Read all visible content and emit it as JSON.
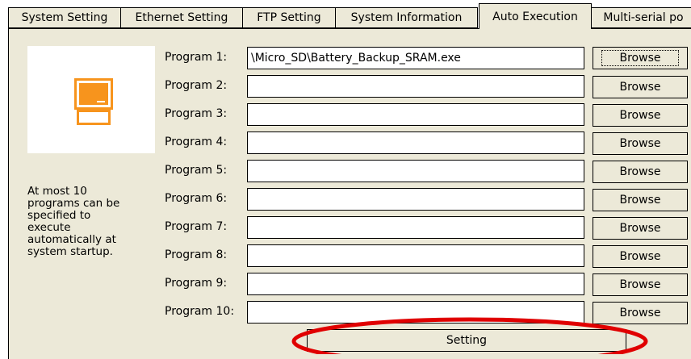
{
  "tabs": [
    {
      "label": "System Setting",
      "active": false
    },
    {
      "label": "Ethernet Setting",
      "active": false
    },
    {
      "label": "FTP Setting",
      "active": false
    },
    {
      "label": "System Information",
      "active": false
    },
    {
      "label": "Auto Execution",
      "active": true
    },
    {
      "label": "Multi-serial po",
      "active": false
    }
  ],
  "icon": {
    "name": "computer-icon",
    "color": "#f7941d"
  },
  "note": "At most 10\nprograms can be\nspecified to\nexecute\nautomatically at\nsystem startup.",
  "programs": [
    {
      "label": "Program 1:",
      "value": "\\Micro_SD\\Battery_Backup_SRAM.exe",
      "button": "Browse"
    },
    {
      "label": "Program 2:",
      "value": "",
      "button": "Browse"
    },
    {
      "label": "Program 3:",
      "value": "",
      "button": "Browse"
    },
    {
      "label": "Program 4:",
      "value": "",
      "button": "Browse"
    },
    {
      "label": "Program 5:",
      "value": "",
      "button": "Browse"
    },
    {
      "label": "Program 6:",
      "value": "",
      "button": "Browse"
    },
    {
      "label": "Program 7:",
      "value": "",
      "button": "Browse"
    },
    {
      "label": "Program 8:",
      "value": "",
      "button": "Browse"
    },
    {
      "label": "Program 9:",
      "value": "",
      "button": "Browse"
    },
    {
      "label": "Program 10:",
      "value": "",
      "button": "Browse"
    }
  ],
  "setting_button": "Setting",
  "highlight_color": "#e00000"
}
